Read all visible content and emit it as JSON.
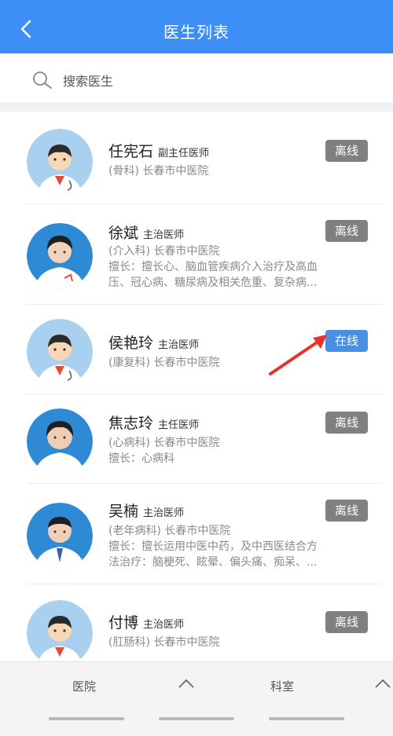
{
  "header": {
    "title": "医生列表"
  },
  "search": {
    "placeholder": "搜索医生"
  },
  "doctors": [
    {
      "name": "任宪石",
      "title": "副主任医师",
      "dept": "(骨科) 长春市中医院",
      "specialty": "",
      "specialty2": "",
      "status": "离线",
      "status_color": "#808080"
    },
    {
      "name": "徐斌",
      "title": "主治医师",
      "dept": "(介入科) 长春市中医院",
      "specialty": "擅长：擅长心、脑血管疾病介入治疗及高血",
      "specialty2": "压、冠心病、糖尿病及相关危重、复杂病...",
      "status": "离线",
      "status_color": "#808080"
    },
    {
      "name": "侯艳玲",
      "title": "主治医师",
      "dept": "(康复科) 长春市中医院",
      "specialty": "",
      "specialty2": "",
      "status": "在线",
      "status_color": "#4a90e2"
    },
    {
      "name": "焦志玲",
      "title": "主任医师",
      "dept": "(心病科) 长春市中医院",
      "specialty": "擅长：心病科",
      "specialty2": "",
      "status": "离线",
      "status_color": "#808080"
    },
    {
      "name": "吴楠",
      "title": "主治医师",
      "dept": "(老年病科) 长春市中医院",
      "specialty": "擅长：擅长运用中医中药，及中西医结合方",
      "specialty2": "法治疗：脑梗死、眩晕、偏头痛、痴呆、...",
      "status": "离线",
      "status_color": "#808080"
    },
    {
      "name": "付博",
      "title": "主治医师",
      "dept": "(肛肠科) 长春市中医院",
      "specialty": "",
      "specialty2": "",
      "status": "离线",
      "status_color": "#808080"
    }
  ],
  "bottom": {
    "tab1": "医院",
    "tab2": "科室"
  },
  "colors": {
    "primary": "#3d8ff6",
    "online": "#4a90e2",
    "offline": "#808080",
    "arrow": "#e8322b"
  }
}
